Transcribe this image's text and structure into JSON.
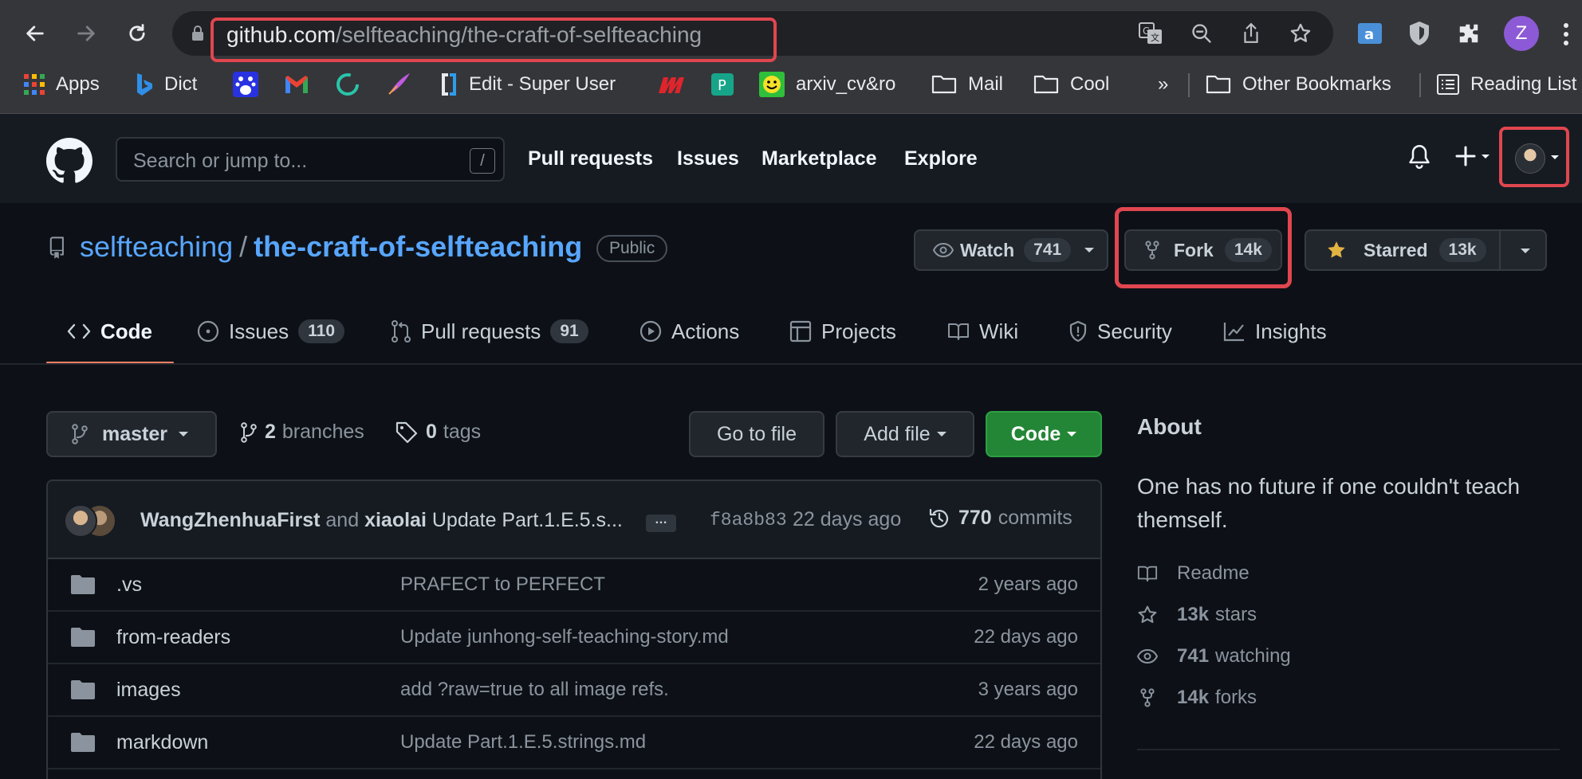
{
  "browser": {
    "url_host": "github.com",
    "url_path": "/selfteaching/the-craft-of-selfteaching",
    "profile_initial": "Z",
    "bookmarks": [
      {
        "label": "Apps",
        "icon": "apps-grid-icon"
      },
      {
        "label": "Dict",
        "icon": "bing-icon"
      },
      {
        "label": "",
        "icon": "baidu-icon"
      },
      {
        "label": "",
        "icon": "gmail-icon"
      },
      {
        "label": "",
        "icon": "refresh-circle-icon"
      },
      {
        "label": "",
        "icon": "quill-icon"
      },
      {
        "label": "Edit - Super User",
        "icon": "superuser-icon"
      },
      {
        "label": "",
        "icon": "m-logo-icon"
      },
      {
        "label": "",
        "icon": "teal-p-icon"
      },
      {
        "label": "arxiv_cv&ro",
        "icon": "smiley-icon"
      },
      {
        "label": "Mail",
        "icon": "folder-icon"
      },
      {
        "label": "Cool",
        "icon": "folder-icon"
      },
      {
        "label": "»",
        "icon": ""
      },
      {
        "label": "Other Bookmarks",
        "icon": "folder-icon"
      },
      {
        "label": "Reading List",
        "icon": "reading-list-icon"
      }
    ]
  },
  "github": {
    "search_placeholder": "Search or jump to...",
    "search_shortcut": "/",
    "nav": [
      "Pull requests",
      "Issues",
      "Marketplace",
      "Explore"
    ]
  },
  "repo": {
    "owner": "selfteaching",
    "separator": "/",
    "name": "the-craft-of-selfteaching",
    "visibility": "Public",
    "watch_label": "Watch",
    "watch_count": "741",
    "fork_label": "Fork",
    "fork_count": "14k",
    "star_label": "Starred",
    "star_count": "13k"
  },
  "tabs": [
    {
      "label": "Code",
      "icon": "code-icon",
      "count": ""
    },
    {
      "label": "Issues",
      "icon": "issue-opened-icon",
      "count": "110"
    },
    {
      "label": "Pull requests",
      "icon": "git-pull-request-icon",
      "count": "91"
    },
    {
      "label": "Actions",
      "icon": "play-icon",
      "count": ""
    },
    {
      "label": "Projects",
      "icon": "table-icon",
      "count": ""
    },
    {
      "label": "Wiki",
      "icon": "book-icon",
      "count": ""
    },
    {
      "label": "Security",
      "icon": "shield-icon",
      "count": ""
    },
    {
      "label": "Insights",
      "icon": "graph-icon",
      "count": ""
    }
  ],
  "toolbar": {
    "branch": "master",
    "branches_count": "2",
    "branches_label": "branches",
    "tags_count": "0",
    "tags_label": "tags",
    "goto_file": "Go to file",
    "add_file": "Add file",
    "code": "Code"
  },
  "commit": {
    "author1": "WangZhenhuaFirst",
    "and": "and",
    "author2": "xiaolai",
    "message": "Update Part.1.E.5.s...",
    "ellipsis": "…",
    "sha": "f8a8b83",
    "ago": "22 days ago",
    "count": "770",
    "count_label": "commits"
  },
  "files": [
    {
      "name": ".vs",
      "message": "PRAFECT to PERFECT",
      "age": "2 years ago"
    },
    {
      "name": "from-readers",
      "message": "Update junhong-self-teaching-story.md",
      "age": "22 days ago"
    },
    {
      "name": "images",
      "message": "add ?raw=true to all image refs.",
      "age": "3 years ago"
    },
    {
      "name": "markdown",
      "message": "Update Part.1.E.5.strings.md",
      "age": "22 days ago"
    }
  ],
  "about": {
    "title": "About",
    "description": "One has no future if one couldn't teach themself.",
    "readme": "Readme",
    "stars_count": "13k",
    "stars_label": "stars",
    "watching_count": "741",
    "watching_label": "watching",
    "forks_count": "14k",
    "forks_label": "forks"
  },
  "colors": {
    "accent_link": "#58a6ff",
    "highlight_red": "#e0464f",
    "code_button": "#238636",
    "tab_underline": "#f78166"
  }
}
